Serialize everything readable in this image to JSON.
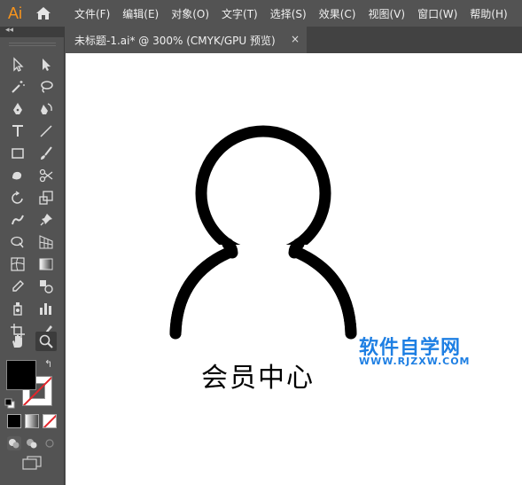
{
  "app": {
    "logo": "Ai",
    "accent_color": "#f7941d"
  },
  "menubar": {
    "items": [
      {
        "label": "文件(F)"
      },
      {
        "label": "编辑(E)"
      },
      {
        "label": "对象(O)"
      },
      {
        "label": "文字(T)"
      },
      {
        "label": "选择(S)"
      },
      {
        "label": "效果(C)"
      },
      {
        "label": "视图(V)"
      },
      {
        "label": "窗口(W)"
      },
      {
        "label": "帮助(H)"
      }
    ]
  },
  "document_tab": {
    "title": "未标题-1.ai* @ 300% (CMYK/GPU 预览)",
    "close": "×"
  },
  "toolbar": {
    "collapse": "◂◂",
    "tools": [
      "selection-tool",
      "direct-selection-tool",
      "magic-wand-tool",
      "lasso-tool",
      "pen-tool",
      "curvature-tool",
      "type-tool",
      "line-segment-tool",
      "rectangle-tool",
      "paintbrush-tool",
      "shaper-tool",
      "scissors-tool",
      "rotate-tool",
      "scale-tool",
      "warp-tool",
      "puppet-warp-tool",
      "shape-builder-tool",
      "perspective-grid-tool",
      "mesh-tool",
      "gradient-tool",
      "eyedropper-tool",
      "blend-tool",
      "symbol-sprayer-tool",
      "column-graph-tool",
      "artboard-tool",
      "slice-tool",
      "hand-tool",
      "zoom-tool"
    ],
    "fill_color": "#000000",
    "stroke_color": "none"
  },
  "artwork": {
    "caption": "会员中心",
    "watermark_title": "软件自学网",
    "watermark_url": "WWW.RJZXW.COM",
    "watermark_color": "#1e7fe3"
  }
}
